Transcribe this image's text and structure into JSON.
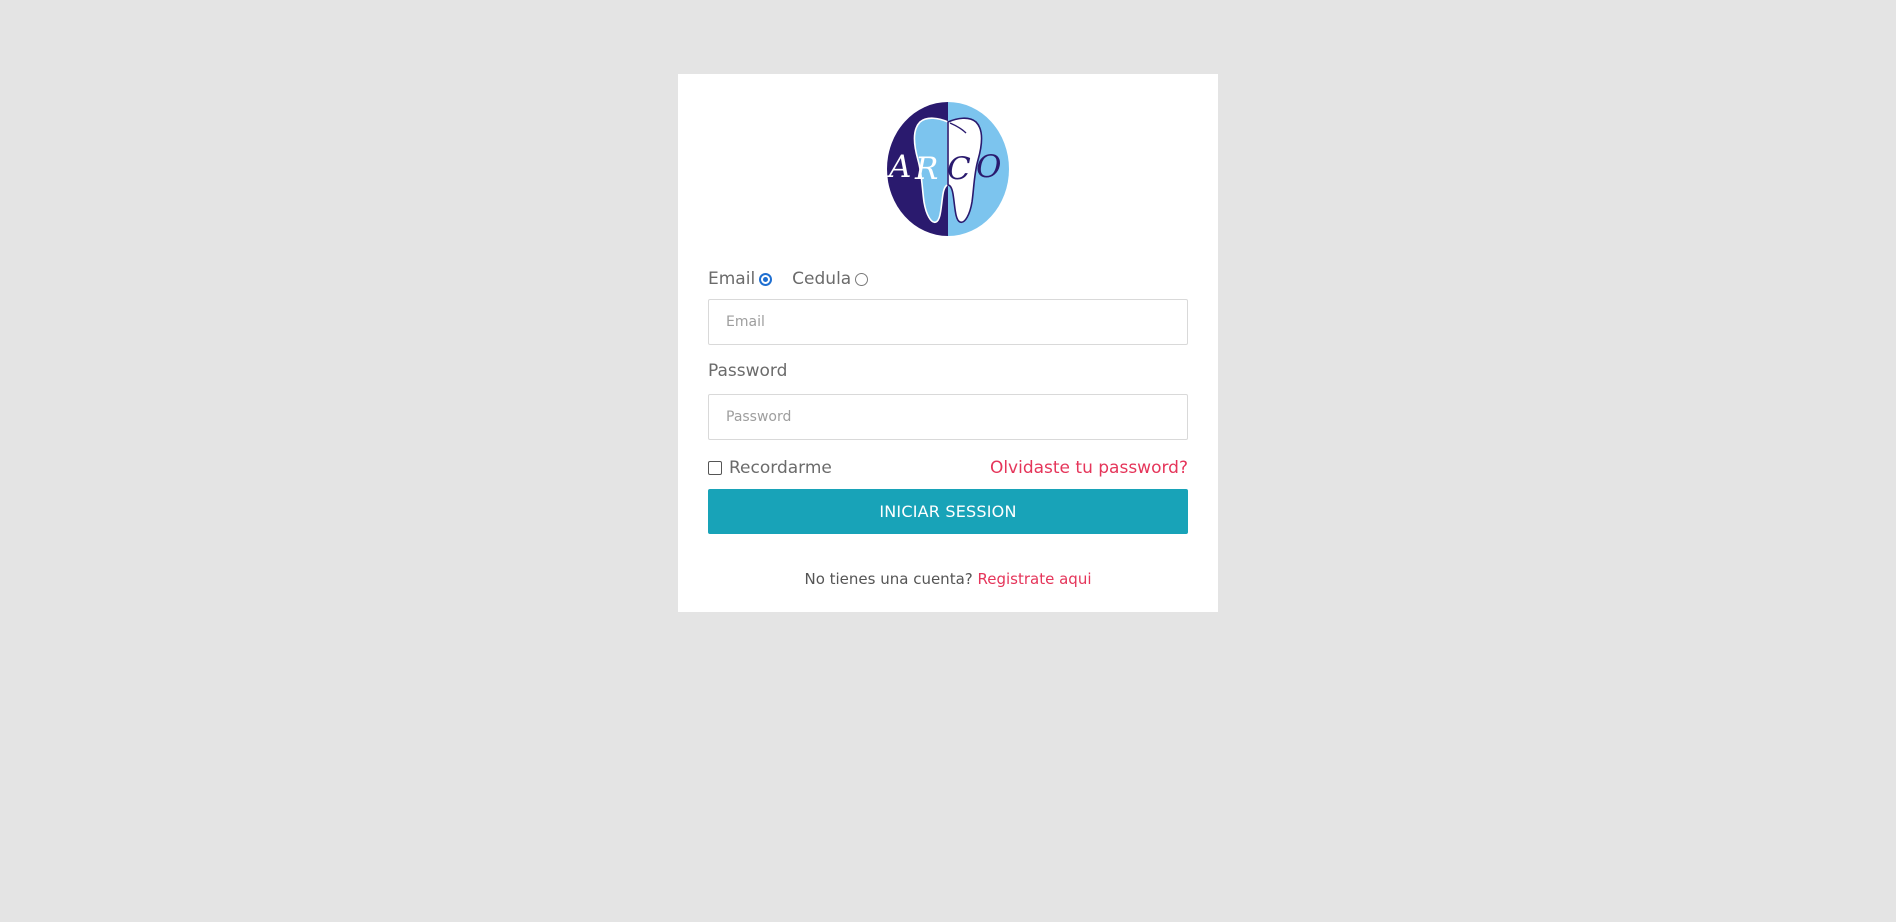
{
  "logo": {
    "text": "ARCO",
    "colors": {
      "dark": "#2a1a6e",
      "light": "#7cc4ee"
    }
  },
  "login_type": {
    "options": [
      {
        "label": "Email",
        "selected": true
      },
      {
        "label": "Cedula",
        "selected": false
      }
    ]
  },
  "email_field": {
    "placeholder": "Email",
    "value": ""
  },
  "password": {
    "label": "Password",
    "placeholder": "Password",
    "value": ""
  },
  "remember": {
    "label": "Recordarme",
    "checked": false
  },
  "forgot_link": "Olvidaste tu password?",
  "submit_label": "INICIAR SESSION",
  "register": {
    "prompt": "No tienes una cuenta?",
    "link": "Registrate aqui"
  },
  "colors": {
    "background": "#e4e4e4",
    "card": "#ffffff",
    "primary_button": "#18a3b8",
    "link": "#e5355a",
    "radio_active": "#1f6fd1"
  }
}
